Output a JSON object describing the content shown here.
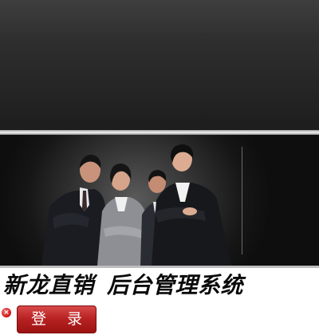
{
  "header": {
    "system_title_part1": "新龙直销",
    "system_title_part2": "后台管理系统"
  },
  "actions": {
    "login_label": "登 录",
    "close_symbol": "×"
  },
  "icons": [
    "close-icon"
  ],
  "colors": {
    "background_dark": "#1d1d1d",
    "login_button": "#b92323",
    "close_icon": "#d62020",
    "title_text": "#0a0a0a"
  }
}
